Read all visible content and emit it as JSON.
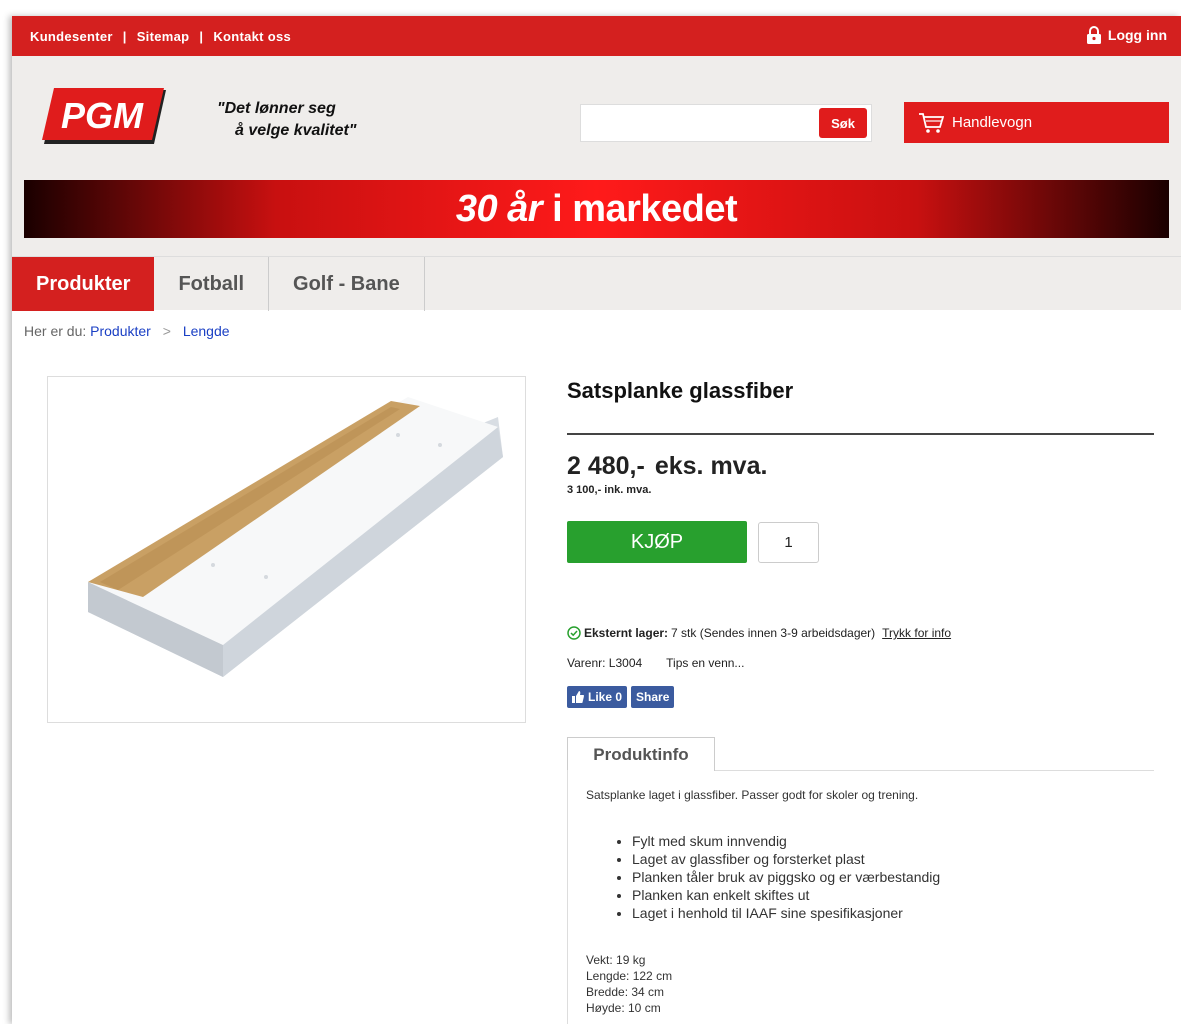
{
  "topbar": {
    "links": [
      "Kundesenter",
      "Sitemap",
      "Kontakt oss"
    ],
    "separator": "|",
    "login_label": "Logg inn"
  },
  "header": {
    "logo_text": "PGM",
    "slogan_line1": "\"Det lønner seg",
    "slogan_line2": "å velge kvalitet\"",
    "search_placeholder": "",
    "search_button": "Søk",
    "cart_label": "Handlevogn"
  },
  "banner": {
    "years": "30 år",
    "rest": "i markedet"
  },
  "nav": {
    "tabs": [
      "Produkter",
      "Fotball",
      "Golf - Bane"
    ],
    "active_index": 0
  },
  "breadcrumb": {
    "prefix": "Her er du:",
    "items": [
      "Produkter",
      "Lengde"
    ],
    "separator": ">"
  },
  "product": {
    "title": "Satsplanke glassfiber",
    "price": "2 480,-",
    "price_suffix": "eks. mva.",
    "price_incl": "3 100,- ink. mva.",
    "buy_label": "KJØP",
    "quantity": "1",
    "stock_label": "Eksternt lager:",
    "stock_text": "7 stk (Sendes innen 3-9 arbeidsdager)",
    "stock_info_link": "Trykk for info",
    "varenr": "Varenr: L3004",
    "tips": "Tips en venn...",
    "like_label": "Like 0",
    "share_label": "Share"
  },
  "info_tab": {
    "label": "Produktinfo",
    "description": "Satsplanke laget i glassfiber. Passer godt for skoler og trening.",
    "bullets": [
      "Fylt med skum innvendig",
      "Laget av glassfiber og forsterket plast",
      "Planken tåler bruk av piggsko og er værbestandig",
      "Planken kan enkelt skiftes ut",
      "Laget i henhold til IAAF sine spesifikasjoner"
    ],
    "specs": [
      "Vekt: 19 kg",
      "Lengde: 122 cm",
      "Bredde: 34 cm",
      "Høyde: 10 cm"
    ]
  },
  "colors": {
    "brand_red": "#d4201f",
    "buy_green": "#28a02e",
    "facebook_blue": "#3b5b9f",
    "link_blue": "#1a3fc4"
  },
  "icons": [
    "lock-icon",
    "cart-icon",
    "check-circle-icon",
    "thumbs-up-icon"
  ]
}
